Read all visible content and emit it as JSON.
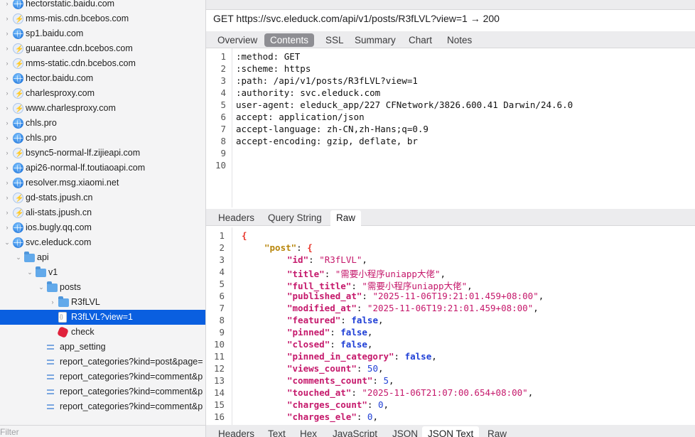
{
  "sidebar": {
    "rows": [
      {
        "label": "hectorstatic.baidu.com",
        "icon": "globe-icon",
        "chev": "›",
        "depth": 0
      },
      {
        "label": "mms-mis.cdn.bcebos.com",
        "icon": "bolt-icon",
        "chev": "›",
        "depth": 0
      },
      {
        "label": "sp1.baidu.com",
        "icon": "globe-icon",
        "chev": "›",
        "depth": 0
      },
      {
        "label": "guarantee.cdn.bcebos.com",
        "icon": "bolt-icon",
        "chev": "›",
        "depth": 0
      },
      {
        "label": "mms-static.cdn.bcebos.com",
        "icon": "bolt-icon",
        "chev": "›",
        "depth": 0
      },
      {
        "label": "hector.baidu.com",
        "icon": "globe-icon",
        "chev": "›",
        "depth": 0
      },
      {
        "label": "charlesproxy.com",
        "icon": "bolt-icon",
        "chev": "›",
        "depth": 0
      },
      {
        "label": "www.charlesproxy.com",
        "icon": "bolt-icon",
        "chev": "›",
        "depth": 0
      },
      {
        "label": "chls.pro",
        "icon": "globe-icon",
        "chev": "›",
        "depth": 0
      },
      {
        "label": "chls.pro",
        "icon": "globe-icon",
        "chev": "›",
        "depth": 0
      },
      {
        "label": "bsync5-normal-lf.zijieapi.com",
        "icon": "bolt-icon",
        "chev": "›",
        "depth": 0
      },
      {
        "label": "api26-normal-lf.toutiaoapi.com",
        "icon": "globe-icon",
        "chev": "›",
        "depth": 0
      },
      {
        "label": "resolver.msg.xiaomi.net",
        "icon": "globe-icon",
        "chev": "›",
        "depth": 0
      },
      {
        "label": "gd-stats.jpush.cn",
        "icon": "bolt-icon",
        "chev": "›",
        "depth": 0
      },
      {
        "label": "ali-stats.jpush.cn",
        "icon": "bolt-icon",
        "chev": "›",
        "depth": 0
      },
      {
        "label": "ios.bugly.qq.com",
        "icon": "globe-icon",
        "chev": "›",
        "depth": 0
      },
      {
        "label": "svc.eleduck.com",
        "icon": "globe-icon",
        "chev": "⌄",
        "depth": 0
      },
      {
        "label": "api",
        "icon": "folder-icon",
        "chev": "⌄",
        "depth": 1
      },
      {
        "label": "v1",
        "icon": "folder-icon",
        "chev": "⌄",
        "depth": 2
      },
      {
        "label": "posts",
        "icon": "folder-icon",
        "chev": "⌄",
        "depth": 3
      },
      {
        "label": "R3fLVL",
        "icon": "folder-icon",
        "chev": "›",
        "depth": 4
      },
      {
        "label": "R3fLVL?view=1",
        "icon": "doc-icon",
        "chev": "",
        "depth": 4,
        "selected": true
      },
      {
        "label": "check",
        "icon": "stop-icon",
        "chev": "",
        "depth": 4
      },
      {
        "label": "app_setting",
        "icon": "lines-icon",
        "chev": "",
        "depth": 3
      },
      {
        "label": "report_categories?kind=post&page=",
        "icon": "lines-icon",
        "chev": "",
        "depth": 3
      },
      {
        "label": "report_categories?kind=comment&p",
        "icon": "lines-icon",
        "chev": "",
        "depth": 3
      },
      {
        "label": "report_categories?kind=comment&p",
        "icon": "lines-icon",
        "chev": "",
        "depth": 3
      },
      {
        "label": "report_categories?kind=comment&p",
        "icon": "lines-icon",
        "chev": "",
        "depth": 3
      }
    ],
    "filter_placeholder": "Filter"
  },
  "main": {
    "request_title": "GET https://svc.eleduck.com/api/v1/posts/R3fLVL?view=1 → 200",
    "tabs": [
      "Overview",
      "Contents",
      "SSL",
      "Summary",
      "Chart",
      "Notes"
    ],
    "active_tab": 1,
    "request_lines": [
      ":method: GET",
      ":scheme: https",
      ":path: /api/v1/posts/R3fLVL?view=1",
      ":authority: svc.eleduck.com",
      "user-agent: eleduck_app/227 CFNetwork/3826.600.41 Darwin/24.6.0",
      "accept: application/json",
      "accept-language: zh-CN,zh-Hans;q=0.9",
      "accept-encoding: gzip, deflate, br",
      "",
      ""
    ],
    "request_subtabs": [
      "Headers",
      "Query String",
      "Raw"
    ],
    "request_active_subtab": 2,
    "json_lines": [
      {
        "indent": 0,
        "open": "{"
      },
      {
        "indent": 1,
        "key": "post",
        "open": "{",
        "top": true
      },
      {
        "indent": 2,
        "key": "id",
        "str": "R3fLVL"
      },
      {
        "indent": 2,
        "key": "title",
        "str": "需要小程序uniapp大佬"
      },
      {
        "indent": 2,
        "key": "full_title",
        "str": "需要小程序uniapp大佬"
      },
      {
        "indent": 2,
        "key": "published_at",
        "str": "2025-11-06T19:21:01.459+08:00"
      },
      {
        "indent": 2,
        "key": "modified_at",
        "str": "2025-11-06T19:21:01.459+08:00"
      },
      {
        "indent": 2,
        "key": "featured",
        "bool": "false"
      },
      {
        "indent": 2,
        "key": "pinned",
        "bool": "false"
      },
      {
        "indent": 2,
        "key": "closed",
        "bool": "false"
      },
      {
        "indent": 2,
        "key": "pinned_in_category",
        "bool": "false"
      },
      {
        "indent": 2,
        "key": "views_count",
        "num": "50"
      },
      {
        "indent": 2,
        "key": "comments_count",
        "num": "5"
      },
      {
        "indent": 2,
        "key": "touched_at",
        "str": "2025-11-06T21:07:00.654+08:00"
      },
      {
        "indent": 2,
        "key": "charges_count",
        "num": "0"
      },
      {
        "indent": 2,
        "key": "charges_ele",
        "num": "0"
      }
    ],
    "response_subtabs": [
      "Headers",
      "Text",
      "Hex",
      "JavaScript",
      "JSON",
      "JSON Text",
      "Raw"
    ],
    "response_active_subtab": 5
  },
  "colors": {
    "selection": "#0a5fe0",
    "json_key": "#c5186b",
    "json_bool": "#1f3fd6",
    "json_top_key": "#b8860b"
  }
}
